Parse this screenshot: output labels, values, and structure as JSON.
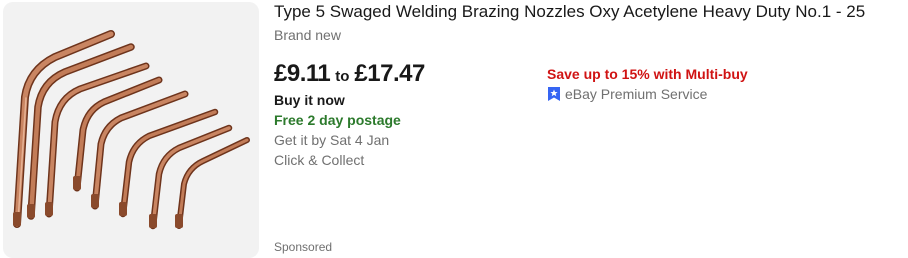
{
  "listing": {
    "title": "Type 5 Swaged Welding Brazing Nozzles Oxy Acetylene Heavy Duty No.1 - 25",
    "condition": "Brand new",
    "price_low": "£9.11",
    "price_sep": "to",
    "price_high": "£17.47",
    "format": "Buy it now",
    "postage": "Free 2 day postage",
    "delivery": "Get it by Sat 4 Jan",
    "collect": "Click & Collect",
    "promo": "Save up to 15% with Multi-buy",
    "premium_service": "eBay Premium Service",
    "premium_icon": "premium-badge-icon",
    "sponsored": "Sponsored",
    "image_alt": "Copper welding brazing nozzles"
  },
  "colors": {
    "thumb_bg": "#f2f2f2",
    "postage_green": "#2c7a2c",
    "promo_red": "#d01313",
    "premium_blue": "#3665f3",
    "copper": "#b86f4a"
  }
}
